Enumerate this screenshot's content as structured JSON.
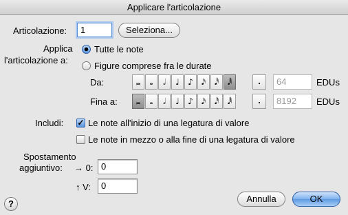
{
  "window": {
    "title": "Applicare l'articolazione"
  },
  "articolazione": {
    "label": "Articolazione:",
    "value": "1",
    "select_label": "Seleziona..."
  },
  "applica": {
    "label_line1": "Applica",
    "label_line2": "l'articolazione a:",
    "option_all": "Tutte le note",
    "option_range": "Figure comprese fra le durate",
    "selected": "Tutte le note"
  },
  "durations": {
    "icons": [
      "𝅜",
      "𝅝",
      "𝅗𝅥",
      "♩",
      "♪",
      "𝅘𝅥𝅯",
      "𝅘𝅥𝅰",
      "𝅘𝅥𝅱"
    ],
    "dot": ".",
    "from": {
      "label": "Da:",
      "value": "64",
      "unit": "EDUs",
      "selected_index": 7
    },
    "to": {
      "label": "Fina a:",
      "value": "8192",
      "unit": "EDUs",
      "selected_index": 0
    }
  },
  "includi": {
    "label": "Includi:",
    "option1": {
      "label": "Le note all'inizio di una legatura di valore",
      "checked": true,
      "mark": "✓"
    },
    "option2": {
      "label": "Le note in mezzo o alla fine di una legatura di valore",
      "checked": false,
      "mark": ""
    }
  },
  "spostamento": {
    "label_line1": "Spostamento",
    "label_line2": "aggiuntivo:",
    "h_label": "→ 0:",
    "h_value": "0",
    "v_label": "↑ V:",
    "v_value": "0"
  },
  "buttons": {
    "cancel": "Annulla",
    "ok": "OK",
    "help": "?"
  }
}
